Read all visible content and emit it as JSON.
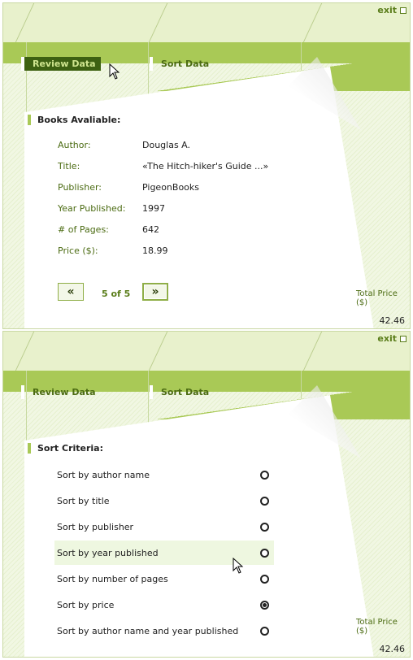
{
  "header": {
    "exit_label": "exit"
  },
  "tabs": {
    "review": "Review Data",
    "sort": "Sort Data"
  },
  "review_panel": {
    "section_title": "Books Avaliable:",
    "fields": [
      {
        "label": "Author:",
        "value": "Douglas A."
      },
      {
        "label": "Title:",
        "value": "«The Hitch-hiker's Guide ...»"
      },
      {
        "label": "Publisher:",
        "value": "PigeonBooks"
      },
      {
        "label": "Year Published:",
        "value": "1997"
      },
      {
        "label": "# of Pages:",
        "value": "642"
      },
      {
        "label": "Price ($):",
        "value": "18.99"
      }
    ],
    "pager": {
      "prev": "«",
      "next": "»",
      "info": "5 of 5"
    },
    "total_label": "Total Price ($)",
    "total_value": "42.46"
  },
  "sort_panel": {
    "section_title": "Sort Criteria:",
    "options": [
      {
        "label": "Sort by author name",
        "checked": false
      },
      {
        "label": "Sort by title",
        "checked": false
      },
      {
        "label": "Sort by publisher",
        "checked": false
      },
      {
        "label": "Sort by year published",
        "checked": false
      },
      {
        "label": "Sort by number of pages",
        "checked": false
      },
      {
        "label": "Sort by price",
        "checked": true
      },
      {
        "label": "Sort by author name and year published",
        "checked": false
      }
    ],
    "total_label": "Total Price ($)",
    "total_value": "42.46"
  },
  "colors": {
    "accent": "#a9c956",
    "dark_tab": "#3d6112",
    "label": "#4b6b12"
  }
}
